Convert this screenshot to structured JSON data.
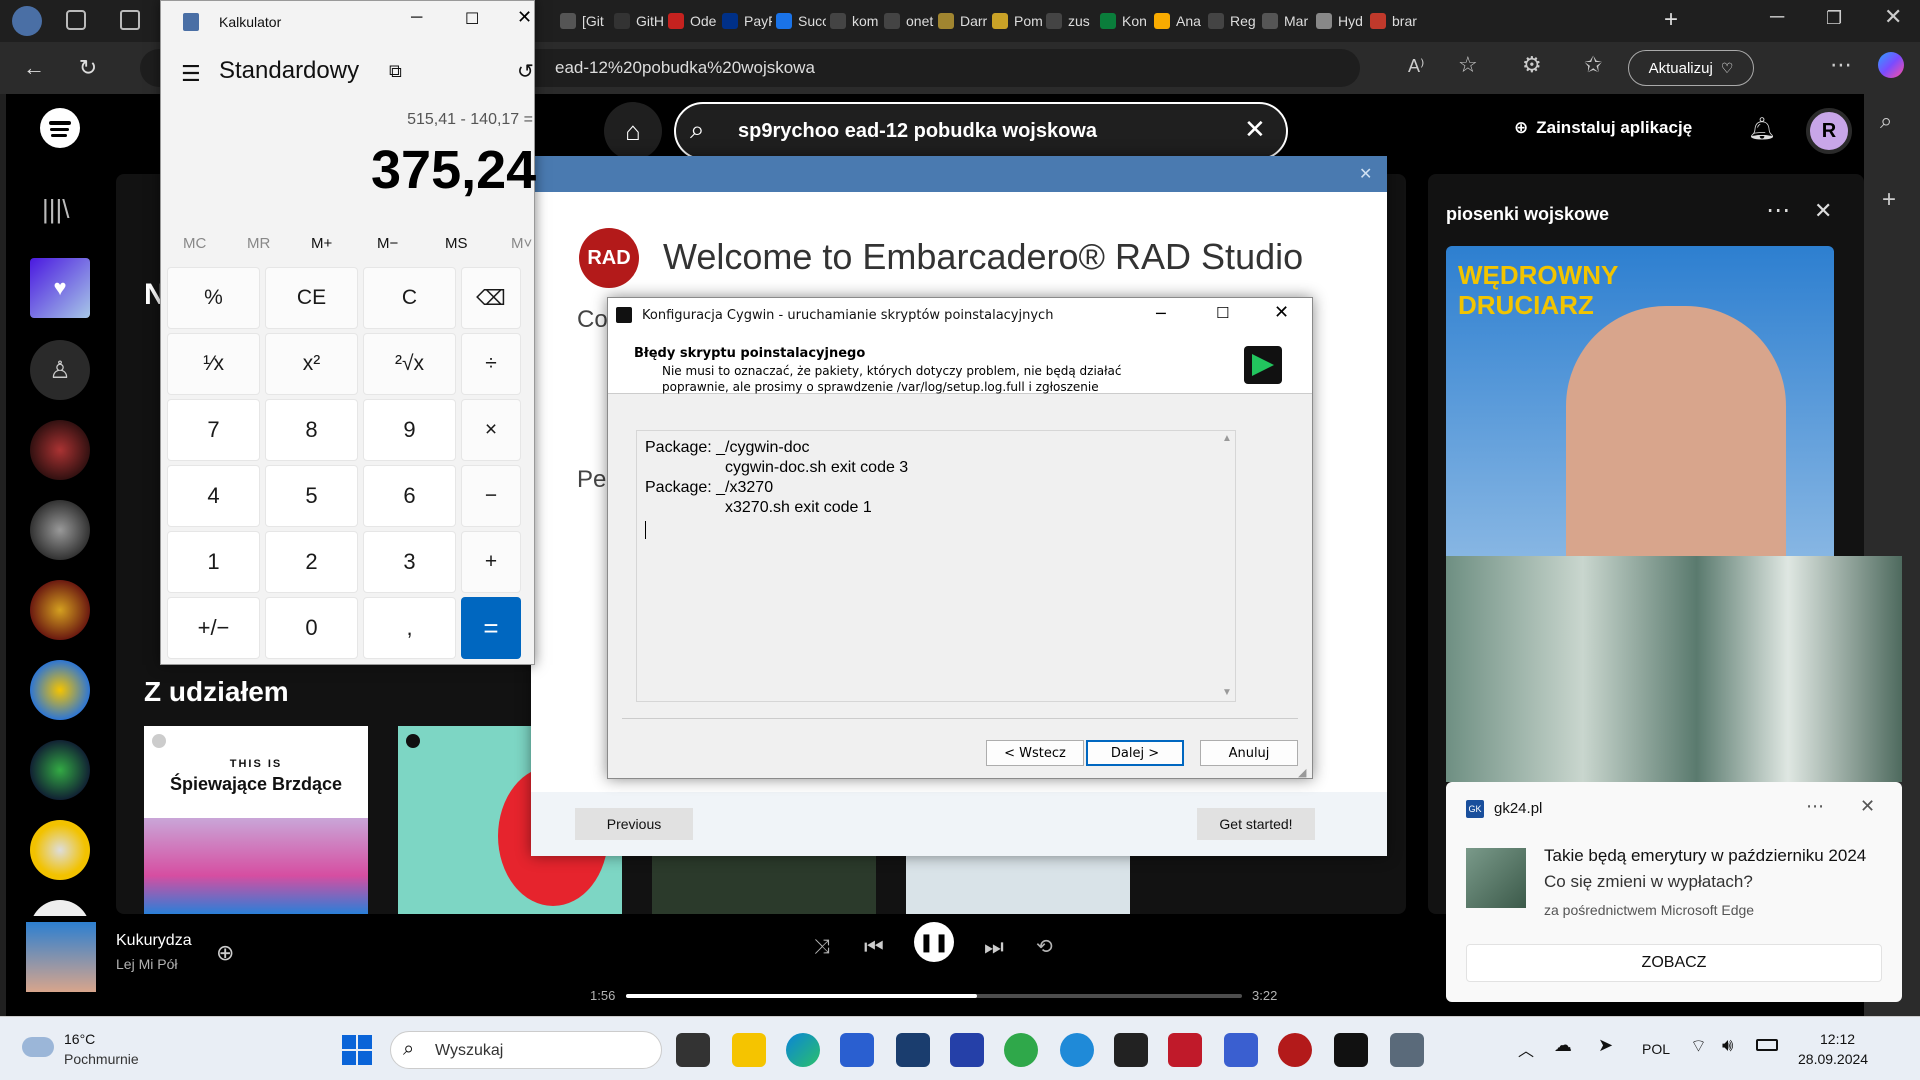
{
  "browser": {
    "tabs": [
      {
        "label": "[Git",
        "color": "#555"
      },
      {
        "label": "GitH",
        "color": "#333"
      },
      {
        "label": "Ode",
        "color": "#c5221f"
      },
      {
        "label": "PayF",
        "color": "#003087"
      },
      {
        "label": "Succ",
        "color": "#1a73e8"
      },
      {
        "label": "kom",
        "color": "#444"
      },
      {
        "label": "onet",
        "color": "#444"
      },
      {
        "label": "Darr",
        "color": "#a08530"
      },
      {
        "label": "Pom",
        "color": "#c9a227"
      },
      {
        "label": "zus",
        "color": "#444"
      },
      {
        "label": "Kon",
        "color": "#0a7d3b"
      },
      {
        "label": "Ana",
        "color": "#f9ab00"
      },
      {
        "label": "Reg",
        "color": "#444"
      },
      {
        "label": "Mar",
        "color": "#555"
      },
      {
        "label": "Hyd",
        "color": "#888"
      },
      {
        "label": "brar",
        "color": "#c0392b"
      }
    ],
    "url": "ead-12%20pobudka%20wojskowa",
    "update_label": "Aktualizuj"
  },
  "spotify": {
    "search_value": "sp9rychoo ead-12 pobudka wojskowa",
    "install_label": "Zainstaluj aplikację",
    "avatar_letter": "R",
    "section_title": "Z udziałem",
    "card1_top": "THIS IS",
    "card1_title": "Śpiewające Brzdące",
    "right_title": "piosenki wojskowe",
    "cover_text": "WĘDROWNY DRUCIARZ",
    "now_playing_title": "Kukurydza",
    "now_playing_artist": "Lej Mi Pół",
    "time_elapsed": "1:56",
    "time_total": "3:22",
    "progress": 0.57
  },
  "calculator": {
    "title": "Kalkulator",
    "mode": "Standardowy",
    "expression": "515,41 - 140,17 =",
    "result": "375,24",
    "memory": [
      "MC",
      "MR",
      "M+",
      "M−",
      "MS",
      "M˅"
    ],
    "keys": [
      [
        "%",
        "CE",
        "C",
        "⌫"
      ],
      [
        "¹⁄x",
        "x²",
        "²√x",
        "÷"
      ],
      [
        "7",
        "8",
        "9",
        "×"
      ],
      [
        "4",
        "5",
        "6",
        "−"
      ],
      [
        "1",
        "2",
        "3",
        "+"
      ],
      [
        "+/−",
        "0",
        ",",
        "="
      ]
    ]
  },
  "rad": {
    "logo": "RAD",
    "welcome": "Welcome to Embarcadero® RAD Studio",
    "prev_label": "Previous",
    "start_label": "Get started!",
    "partial_co": "Co",
    "partial_per": "Pe"
  },
  "cygwin": {
    "title": "Konfiguracja Cygwin - uruchamianie skryptów poinstalacyjnych",
    "heading": "Błędy skryptu poinstalacyjnego",
    "desc1": "Nie musi to oznaczać, że pakiety, których dotyczy problem, nie będą działać",
    "desc2": "poprawnie, ale prosimy o sprawdzenie /var/log/setup.log.full i zgłoszenie",
    "log": [
      "Package: _/cygwin-doc",
      "cygwin-doc.sh exit code 3",
      "Package: _/x3270",
      "x3270.sh exit code 1"
    ],
    "back_label": "< Wstecz",
    "next_label": "Dalej >",
    "cancel_label": "Anuluj"
  },
  "notification": {
    "source": "gk24.pl",
    "title": "Takie będą emerytury w październiku 2024",
    "subtitle": "Co się zmieni w wypłatach?",
    "via": "za pośrednictwem Microsoft Edge",
    "action": "ZOBACZ"
  },
  "taskbar": {
    "temp": "16°C",
    "weather": "Pochmurnie",
    "search_placeholder": "Wyszukaj",
    "lang": "POL",
    "time": "12:12",
    "date": "28.09.2024"
  }
}
